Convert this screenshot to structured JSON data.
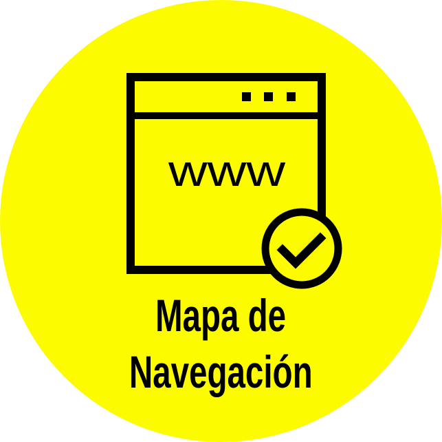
{
  "badge": {
    "background_color": "#fcfb00",
    "foreground_color": "#000000"
  },
  "icon": {
    "name": "browser-window-checkmark-icon",
    "address_text": "www"
  },
  "caption": {
    "line1": "Mapa de",
    "line2": "Navegación"
  }
}
